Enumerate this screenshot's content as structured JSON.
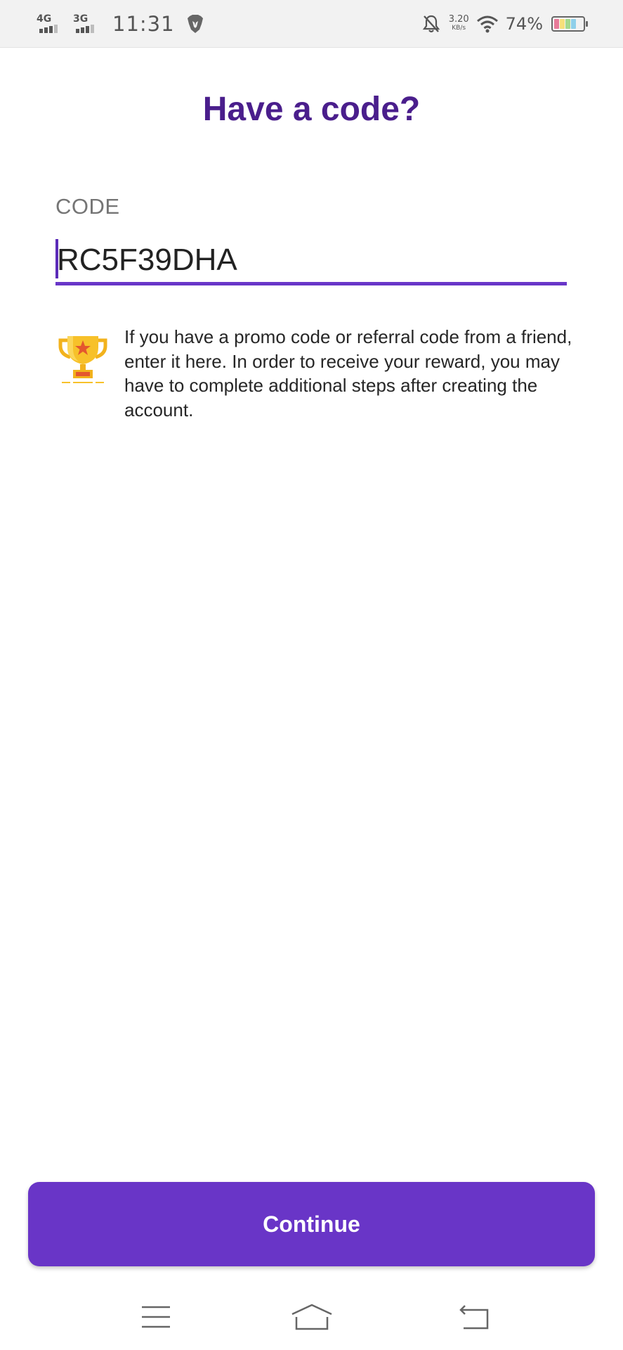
{
  "status_bar": {
    "network1": "4G",
    "network2": "3G",
    "time": "11:31",
    "speed_value": "3.20",
    "speed_unit": "KB/s",
    "battery": "74%",
    "icons": [
      "signal-4g-icon",
      "signal-3g-icon",
      "brave-lion-icon",
      "notifications-off-icon",
      "wifi-icon",
      "battery-icon"
    ]
  },
  "page": {
    "title": "Have a code?"
  },
  "code_field": {
    "label": "CODE",
    "value": "RC5F39DHA"
  },
  "info": {
    "icon": "trophy-icon",
    "text": "If you have a promo code or referral code from a friend, enter it here. In order to receive your reward, you may have to complete additional steps after creating the account."
  },
  "continue_button": {
    "label": "Continue"
  },
  "nav_bar": {
    "icons": [
      "menu-icon",
      "home-icon",
      "back-icon"
    ]
  },
  "colors": {
    "title": "#4a1e8c",
    "accent": "#6935c7",
    "underline": "#6836c8",
    "label": "#757575",
    "text": "#262626"
  }
}
